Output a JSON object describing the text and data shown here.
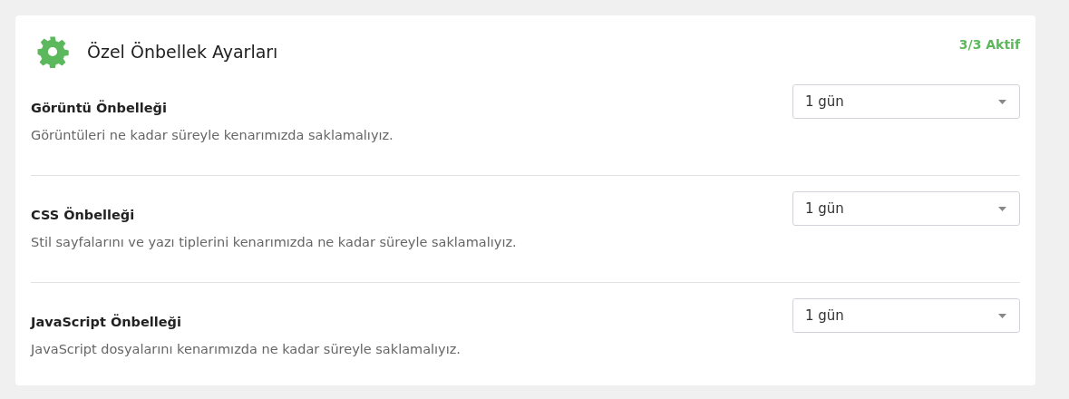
{
  "header": {
    "title": "Özel Önbellek Ayarları",
    "status": "3/3 Aktif"
  },
  "settings": [
    {
      "label": "Görüntü Önbelleği",
      "description": "Görüntüleri ne kadar süreyle kenarımızda saklamalıyız.",
      "value": "1 gün"
    },
    {
      "label": "CSS Önbelleği",
      "description": "Stil sayfalarını ve yazı tiplerini kenarımızda ne kadar süreyle saklamalıyız.",
      "value": "1 gün"
    },
    {
      "label": "JavaScript Önbelleği",
      "description": "JavaScript dosyalarını kenarımızda ne kadar süreyle saklamalıyız.",
      "value": "1 gün"
    }
  ]
}
